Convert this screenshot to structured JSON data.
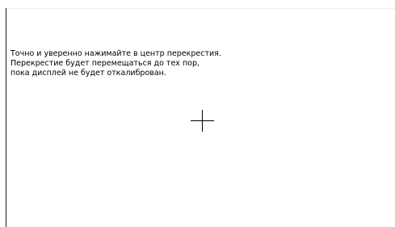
{
  "calibration": {
    "instructions": [
      "Точно и уверенно нажимайте в центр перекрестия.",
      "Перекрестие будет перемещаться до тех пор,",
      "пока дисплей не будет откалиброван."
    ],
    "target_icon": "crosshair-icon"
  },
  "colors": {
    "background": "#ffffff",
    "text": "#000000",
    "crosshair": "#000000"
  }
}
